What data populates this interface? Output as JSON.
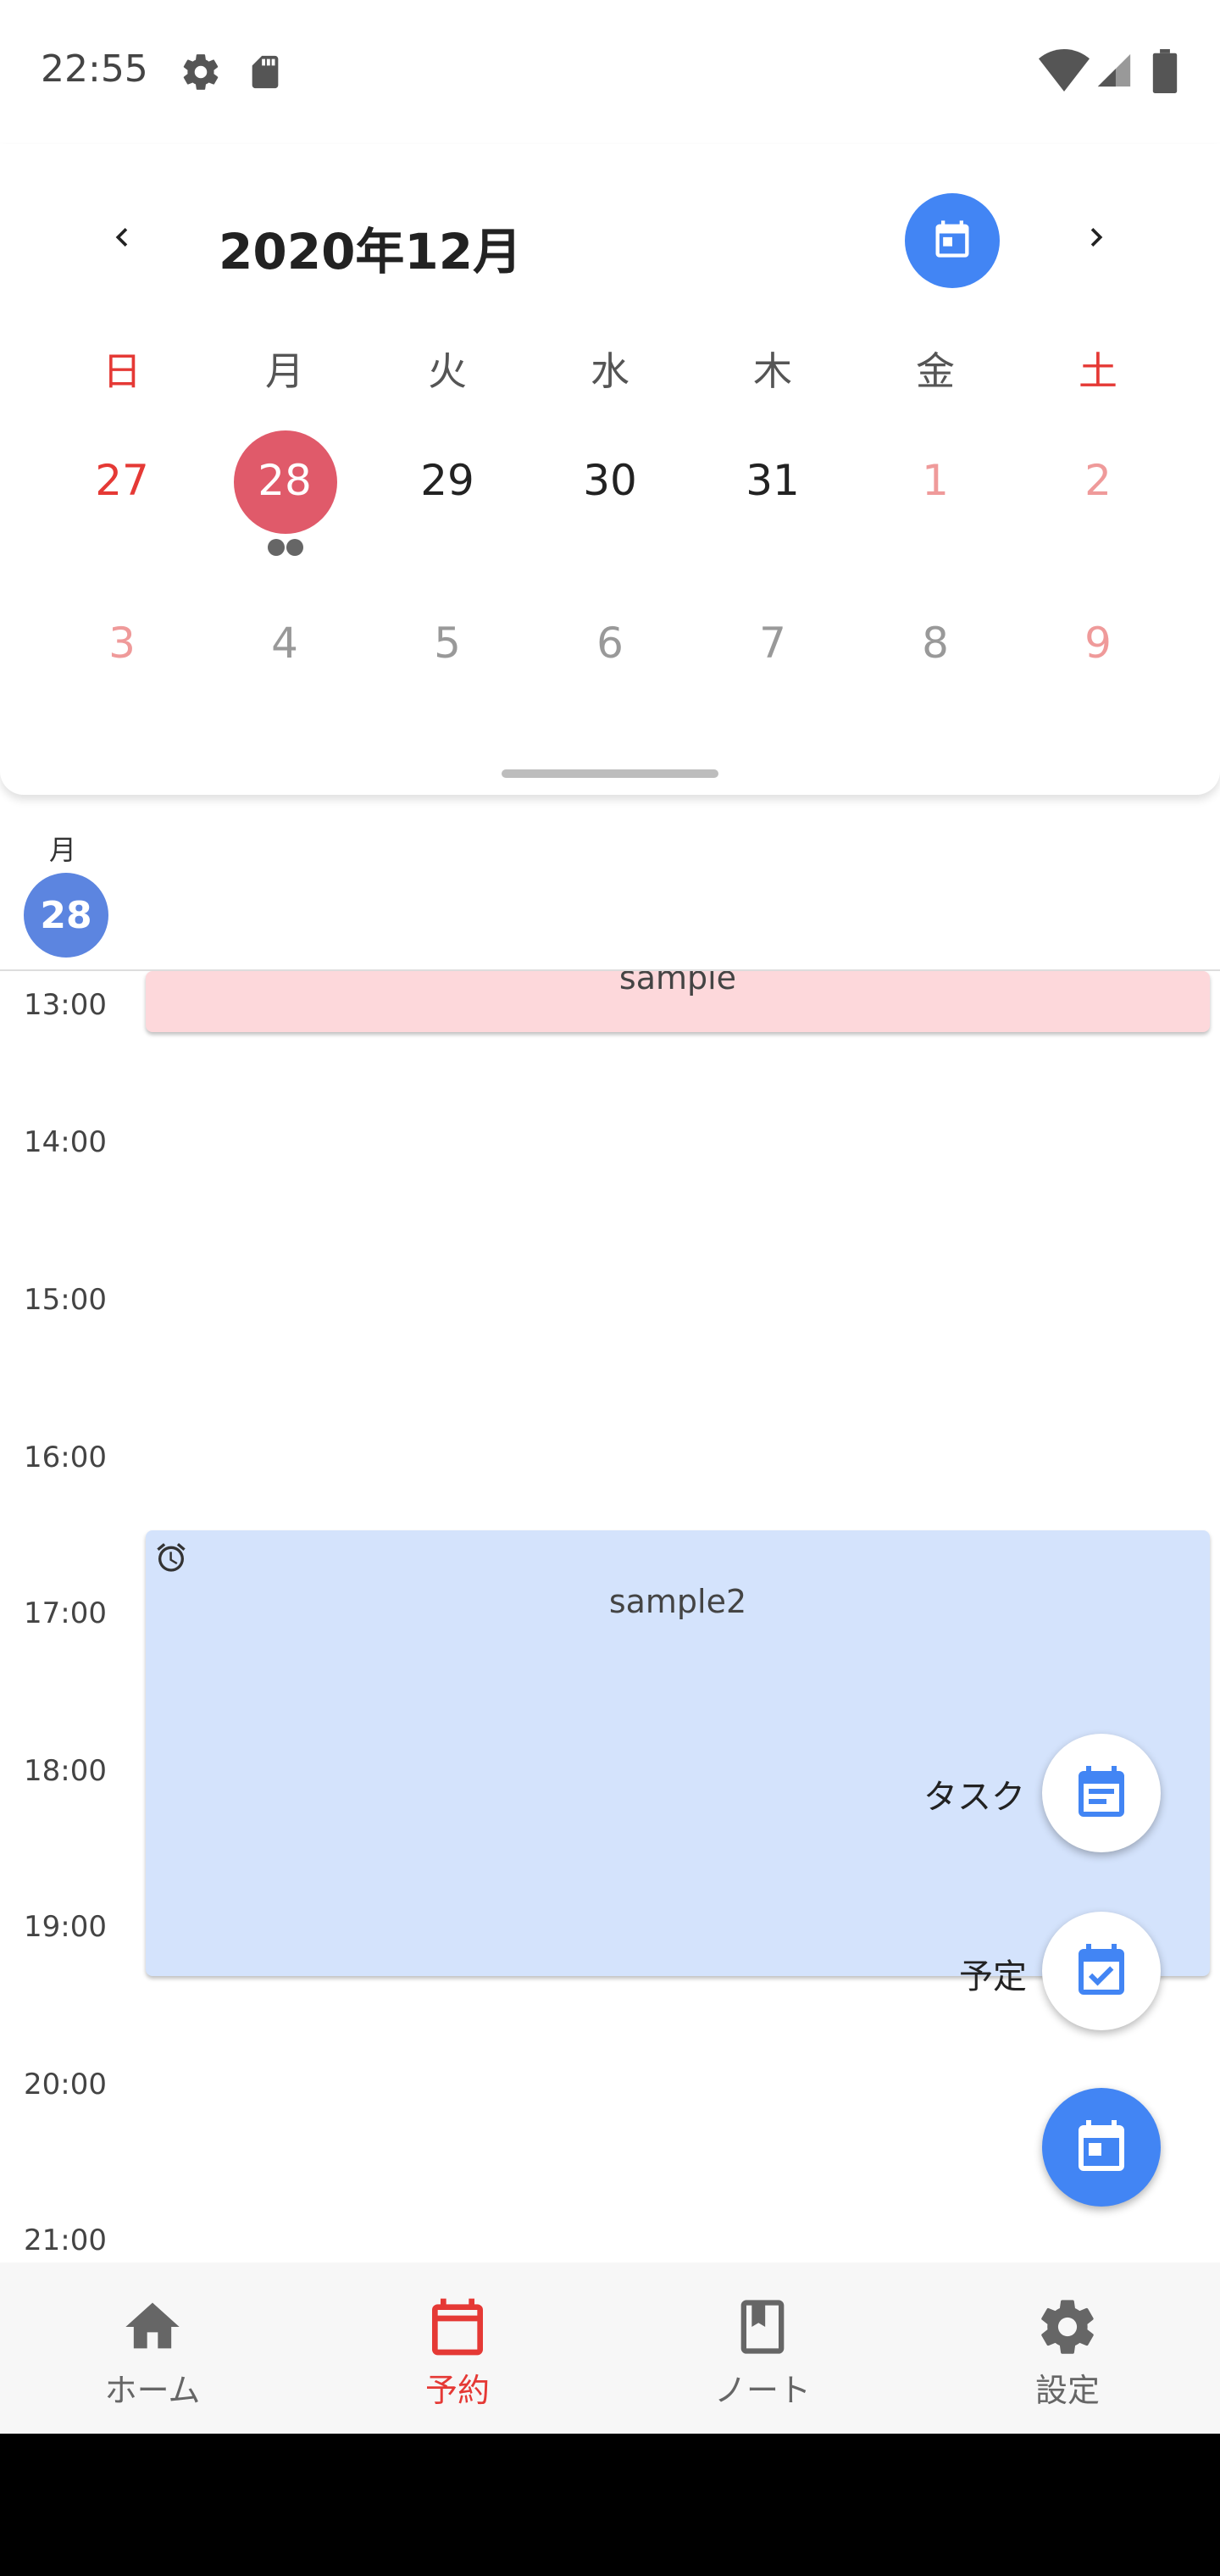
{
  "status_bar": {
    "time": "22:55",
    "icons_left": [
      "gear-icon",
      "sd-card-icon"
    ],
    "icons_right": [
      "wifi-icon",
      "cell-signal-icon",
      "battery-icon"
    ]
  },
  "calendar": {
    "month_title": "2020年12月",
    "prev_icon": "chevron-left-icon",
    "next_icon": "chevron-right-icon",
    "today_icon": "calendar-today-icon",
    "weekdays": [
      "日",
      "月",
      "火",
      "水",
      "木",
      "金",
      "土"
    ],
    "week1": [
      "27",
      "28",
      "29",
      "30",
      "31",
      "1",
      "2"
    ],
    "week2": [
      "3",
      "4",
      "5",
      "6",
      "7",
      "8",
      "9"
    ],
    "selected_day": "28",
    "selected_event_dots": 2
  },
  "day_view": {
    "weekday": "月",
    "date": "28",
    "time_labels": [
      "13:00",
      "14:00",
      "15:00",
      "16:00",
      "17:00",
      "18:00",
      "19:00",
      "20:00",
      "21:00"
    ],
    "events": [
      {
        "title": "sample",
        "color": "#fdd8db"
      },
      {
        "title": "sample2",
        "color": "#d4e3fc",
        "icon": "alarm-icon"
      }
    ]
  },
  "fab": {
    "task_label": "タスク",
    "schedule_label": "予定",
    "task_icon": "task-list-icon",
    "schedule_icon": "event-check-icon",
    "main_icon": "calendar-event-icon"
  },
  "bottom_nav": {
    "items": [
      {
        "label": "ホーム",
        "icon": "home-icon"
      },
      {
        "label": "予約",
        "icon": "calendar-icon",
        "active": true
      },
      {
        "label": "ノート",
        "icon": "bookmark-book-icon"
      },
      {
        "label": "設定",
        "icon": "gear-icon"
      }
    ]
  },
  "colors": {
    "accent": "#4285f4",
    "selected": "#e05a6a",
    "holiday": "#e53935"
  }
}
